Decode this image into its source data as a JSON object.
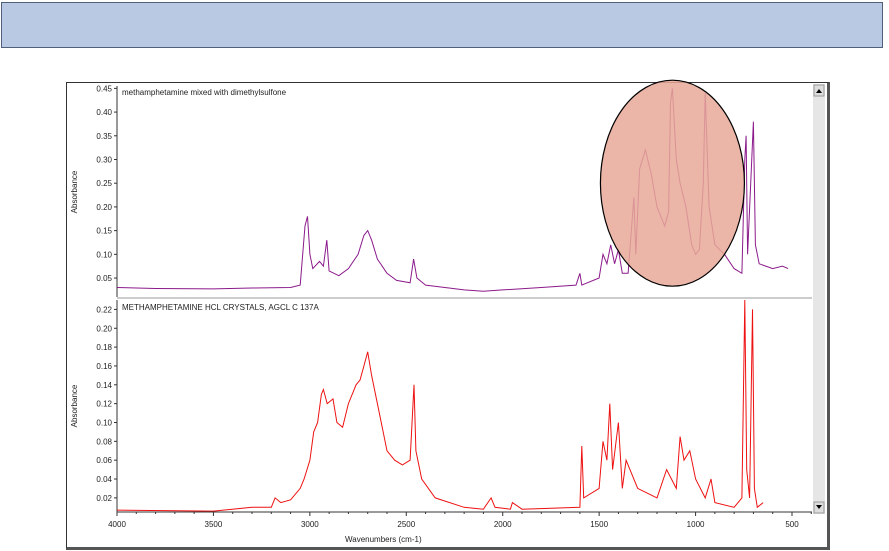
{
  "header": {
    "title": ""
  },
  "chart_data": [
    {
      "type": "line",
      "title": "methamphetamine mixed with dimethylsulfone",
      "ylabel": "Absorbance",
      "xlabel": "",
      "xlim": [
        4000,
        500
      ],
      "ylim": [
        0.01,
        0.455
      ],
      "yticks": [
        "0.05",
        "0.10",
        "0.15",
        "0.20",
        "0.25",
        "0.30",
        "0.35",
        "0.40",
        "0.45"
      ],
      "color": "#8b1a8b",
      "annotation": {
        "type": "ellipse-highlight",
        "color": "#e8a898",
        "center_x": 1120,
        "center_y": 0.25
      },
      "points": [
        [
          4000,
          0.03
        ],
        [
          3800,
          0.028
        ],
        [
          3500,
          0.027
        ],
        [
          3300,
          0.029
        ],
        [
          3100,
          0.03
        ],
        [
          3050,
          0.035
        ],
        [
          3025,
          0.16
        ],
        [
          3012,
          0.18
        ],
        [
          3000,
          0.1
        ],
        [
          2985,
          0.07
        ],
        [
          2950,
          0.085
        ],
        [
          2930,
          0.075
        ],
        [
          2912,
          0.13
        ],
        [
          2900,
          0.065
        ],
        [
          2850,
          0.055
        ],
        [
          2800,
          0.07
        ],
        [
          2750,
          0.1
        ],
        [
          2720,
          0.14
        ],
        [
          2700,
          0.15
        ],
        [
          2680,
          0.13
        ],
        [
          2650,
          0.09
        ],
        [
          2600,
          0.06
        ],
        [
          2550,
          0.045
        ],
        [
          2480,
          0.04
        ],
        [
          2462,
          0.09
        ],
        [
          2445,
          0.05
        ],
        [
          2400,
          0.035
        ],
        [
          2300,
          0.03
        ],
        [
          2200,
          0.025
        ],
        [
          2100,
          0.022
        ],
        [
          2000,
          0.025
        ],
        [
          1800,
          0.03
        ],
        [
          1620,
          0.035
        ],
        [
          1600,
          0.06
        ],
        [
          1590,
          0.035
        ],
        [
          1500,
          0.05
        ],
        [
          1480,
          0.1
        ],
        [
          1460,
          0.08
        ],
        [
          1440,
          0.12
        ],
        [
          1420,
          0.08
        ],
        [
          1400,
          0.11
        ],
        [
          1380,
          0.06
        ],
        [
          1350,
          0.06
        ],
        [
          1320,
          0.22
        ],
        [
          1310,
          0.1
        ],
        [
          1290,
          0.28
        ],
        [
          1260,
          0.32
        ],
        [
          1230,
          0.27
        ],
        [
          1200,
          0.2
        ],
        [
          1160,
          0.16
        ],
        [
          1140,
          0.19
        ],
        [
          1130,
          0.42
        ],
        [
          1120,
          0.45
        ],
        [
          1100,
          0.3
        ],
        [
          1080,
          0.25
        ],
        [
          1050,
          0.2
        ],
        [
          1020,
          0.12
        ],
        [
          1000,
          0.1
        ],
        [
          980,
          0.11
        ],
        [
          960,
          0.25
        ],
        [
          950,
          0.44
        ],
        [
          930,
          0.2
        ],
        [
          900,
          0.12
        ],
        [
          850,
          0.1
        ],
        [
          800,
          0.07
        ],
        [
          760,
          0.06
        ],
        [
          745,
          0.3
        ],
        [
          738,
          0.35
        ],
        [
          730,
          0.1
        ],
        [
          700,
          0.38
        ],
        [
          690,
          0.12
        ],
        [
          670,
          0.08
        ],
        [
          600,
          0.07
        ],
        [
          550,
          0.075
        ],
        [
          520,
          0.07
        ]
      ]
    },
    {
      "type": "line",
      "title": "METHAMPHETAMINE HCL  CRYSTALS, AGCL  C 137A",
      "ylabel": "Absorbance",
      "xlabel": "Wavenumbers (cm-1)",
      "xlim": [
        4000,
        500
      ],
      "ylim": [
        0.005,
        0.23
      ],
      "yticks": [
        "0.02",
        "0.04",
        "0.06",
        "0.08",
        "0.10",
        "0.12",
        "0.14",
        "0.16",
        "0.18",
        "0.20",
        "0.22"
      ],
      "xticks": [
        "4000",
        "3500",
        "3000",
        "2500",
        "2000",
        "1500",
        "1000",
        "500"
      ],
      "color": "#ee1111",
      "points": [
        [
          4000,
          0.007
        ],
        [
          3500,
          0.006
        ],
        [
          3300,
          0.01
        ],
        [
          3200,
          0.01
        ],
        [
          3180,
          0.02
        ],
        [
          3150,
          0.015
        ],
        [
          3100,
          0.018
        ],
        [
          3050,
          0.03
        ],
        [
          3030,
          0.04
        ],
        [
          3000,
          0.06
        ],
        [
          2980,
          0.09
        ],
        [
          2960,
          0.1
        ],
        [
          2940,
          0.13
        ],
        [
          2930,
          0.135
        ],
        [
          2910,
          0.12
        ],
        [
          2880,
          0.125
        ],
        [
          2860,
          0.1
        ],
        [
          2830,
          0.095
        ],
        [
          2800,
          0.12
        ],
        [
          2760,
          0.14
        ],
        [
          2740,
          0.145
        ],
        [
          2720,
          0.16
        ],
        [
          2700,
          0.175
        ],
        [
          2680,
          0.15
        ],
        [
          2650,
          0.12
        ],
        [
          2600,
          0.07
        ],
        [
          2560,
          0.06
        ],
        [
          2520,
          0.055
        ],
        [
          2480,
          0.06
        ],
        [
          2460,
          0.14
        ],
        [
          2450,
          0.07
        ],
        [
          2420,
          0.04
        ],
        [
          2350,
          0.02
        ],
        [
          2200,
          0.01
        ],
        [
          2100,
          0.008
        ],
        [
          2060,
          0.02
        ],
        [
          2040,
          0.01
        ],
        [
          1960,
          0.008
        ],
        [
          1950,
          0.015
        ],
        [
          1900,
          0.008
        ],
        [
          1600,
          0.01
        ],
        [
          1590,
          0.075
        ],
        [
          1580,
          0.02
        ],
        [
          1500,
          0.03
        ],
        [
          1480,
          0.08
        ],
        [
          1460,
          0.06
        ],
        [
          1445,
          0.12
        ],
        [
          1430,
          0.05
        ],
        [
          1400,
          0.1
        ],
        [
          1380,
          0.03
        ],
        [
          1360,
          0.06
        ],
        [
          1300,
          0.03
        ],
        [
          1200,
          0.02
        ],
        [
          1150,
          0.05
        ],
        [
          1100,
          0.03
        ],
        [
          1080,
          0.085
        ],
        [
          1060,
          0.06
        ],
        [
          1030,
          0.07
        ],
        [
          1000,
          0.04
        ],
        [
          950,
          0.02
        ],
        [
          920,
          0.04
        ],
        [
          900,
          0.015
        ],
        [
          800,
          0.01
        ],
        [
          760,
          0.02
        ],
        [
          745,
          0.23
        ],
        [
          735,
          0.05
        ],
        [
          720,
          0.02
        ],
        [
          705,
          0.22
        ],
        [
          695,
          0.03
        ],
        [
          680,
          0.01
        ],
        [
          650,
          0.015
        ]
      ]
    }
  ]
}
